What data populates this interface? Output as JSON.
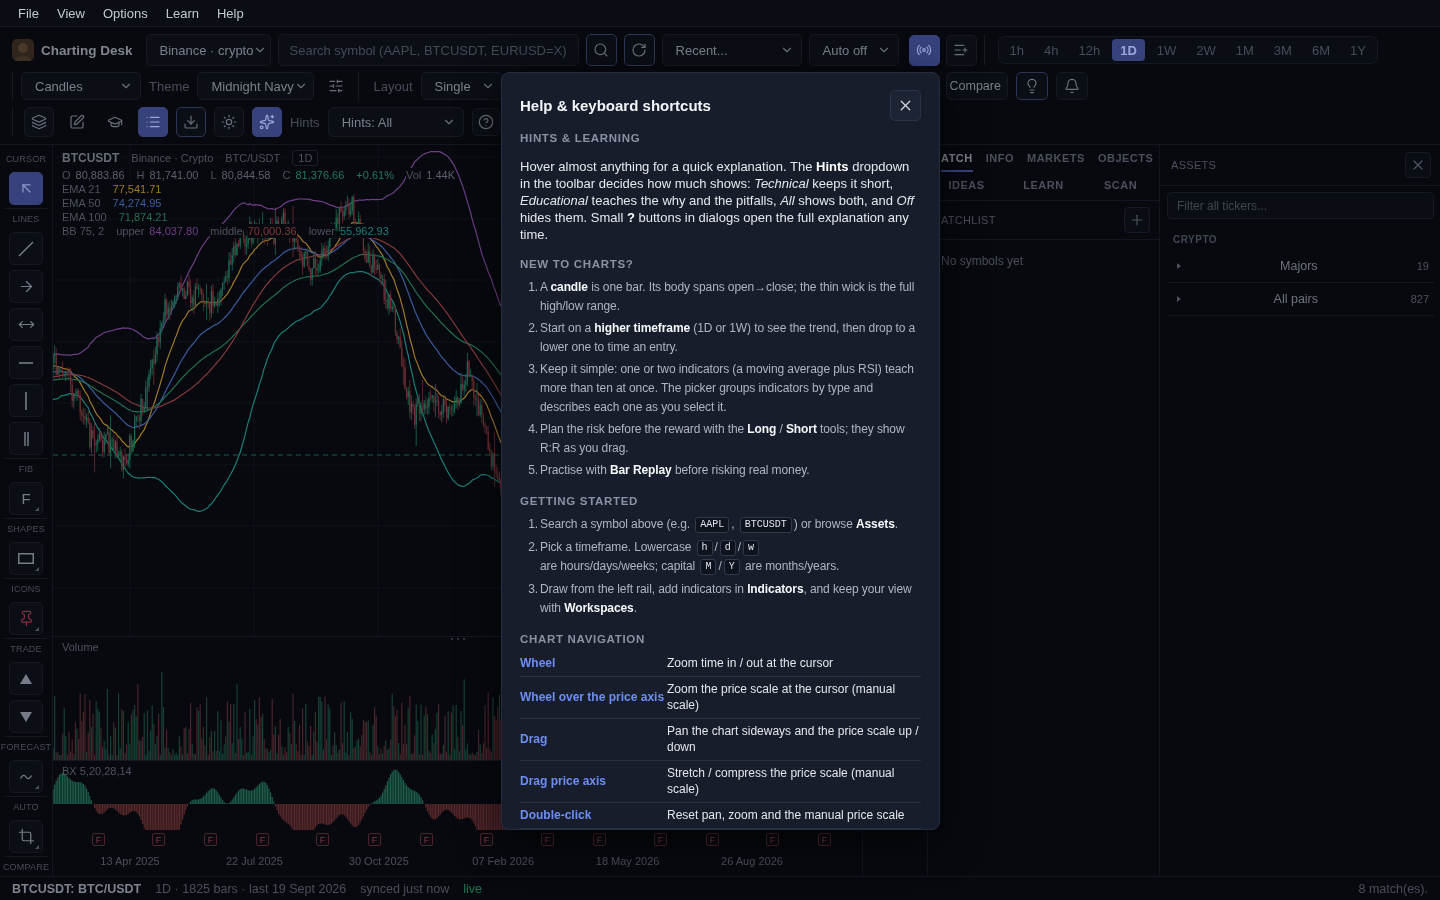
{
  "menu_bar": [
    "File",
    "View",
    "Options",
    "Learn",
    "Help"
  ],
  "top_bar": {
    "title": "Charting Desk",
    "exchange": "Binance · crypto",
    "search": {
      "placeholder": "Search symbol (AAPL, BTCUSDT, EURUSD=X)"
    },
    "search_actions": [
      {
        "kind": "search",
        "selected": false,
        "highlighted": true
      },
      {
        "kind": "refresh",
        "selected": false,
        "highlighted": true
      }
    ],
    "recent": "Recent...",
    "auto_refresh": "Auto off",
    "toggles": [
      {
        "kind": "broadcast",
        "selected": true,
        "highlighted": false
      },
      {
        "kind": "list-add",
        "selected": false,
        "highlighted": false
      }
    ],
    "timeframes": [
      {
        "label": "1h",
        "selected": false
      },
      {
        "label": "4h",
        "selected": false
      },
      {
        "label": "12h",
        "selected": false
      },
      {
        "label": "1D",
        "selected": true
      },
      {
        "label": "1W",
        "selected": false
      },
      {
        "label": "2W",
        "selected": false
      },
      {
        "label": "1M",
        "selected": false
      },
      {
        "label": "3M",
        "selected": false
      },
      {
        "label": "6M",
        "selected": false
      },
      {
        "label": "1Y",
        "selected": false
      }
    ]
  },
  "chart_bar": {
    "chart_type": "Candles",
    "theme": {
      "label": "Theme",
      "value": "Midnight Navy"
    },
    "settings": {
      "kind": "settings",
      "selected": false,
      "highlighted": false
    },
    "layout": {
      "label": "Layout",
      "value": "Single"
    },
    "compare": "Compare",
    "actions": [
      {
        "kind": "idea",
        "selected": false,
        "highlighted": true
      },
      {
        "kind": "alert",
        "selected": false,
        "highlighted": false
      }
    ]
  },
  "tool_bar": {
    "buttons": [
      {
        "kind": "layers",
        "selected": false,
        "highlighted": false
      },
      {
        "kind": "edit",
        "selected": false,
        "highlighted": false
      },
      {
        "kind": "learn",
        "selected": false,
        "highlighted": false
      },
      {
        "kind": "list",
        "selected": true,
        "highlighted": false
      },
      {
        "kind": "download",
        "selected": false,
        "highlighted": true
      },
      {
        "kind": "brightness",
        "selected": false,
        "highlighted": false
      },
      {
        "kind": "hints",
        "selected": true,
        "highlighted": false
      }
    ],
    "hints": {
      "label": "Hints",
      "value": "Hints: All"
    },
    "help": {
      "kind": "help",
      "selected": false,
      "highlighted": false
    }
  },
  "tool_rail": [
    {
      "label": "CURSOR",
      "tools": [
        {
          "kind": "cursor",
          "selected": true,
          "submenu": false
        }
      ]
    },
    {
      "label": "LINES",
      "tools": [
        {
          "kind": "line",
          "selected": false,
          "submenu": false
        },
        {
          "kind": "arrow",
          "selected": false,
          "submenu": false
        },
        {
          "kind": "range",
          "selected": false,
          "submenu": false
        },
        {
          "kind": "hline",
          "selected": false,
          "submenu": false
        },
        {
          "kind": "vline",
          "selected": false,
          "submenu": false
        },
        {
          "kind": "parallel",
          "selected": false,
          "submenu": false
        }
      ]
    },
    {
      "label": "FIB",
      "tools": [
        {
          "kind": "fib",
          "text": "F",
          "selected": false,
          "submenu": true
        }
      ]
    },
    {
      "label": "SHAPES",
      "tools": [
        {
          "kind": "rect",
          "selected": false,
          "submenu": true
        }
      ]
    },
    {
      "label": "ICONS",
      "tools": [
        {
          "kind": "pin",
          "selected": false,
          "submenu": true
        }
      ]
    },
    {
      "label": "TRADE",
      "tools": [
        {
          "kind": "long",
          "selected": false,
          "submenu": false
        },
        {
          "kind": "short",
          "selected": false,
          "submenu": false
        }
      ]
    },
    {
      "label": "FORECAST",
      "tools": [
        {
          "kind": "forecast",
          "selected": false,
          "submenu": true
        }
      ]
    },
    {
      "label": "AUTO",
      "tools": [
        {
          "kind": "auto",
          "selected": false,
          "submenu": true
        }
      ]
    },
    {
      "label": "COMPARE"
    }
  ],
  "legend": {
    "symbol": "BTCUSDT",
    "exchange": "Binance · Crypto",
    "pair": "BTC/USDT",
    "interval": "1D",
    "rising": true,
    "prices": [
      {
        "label": "O",
        "value": "80,883.86"
      },
      {
        "label": "H",
        "value": "81,741.00"
      },
      {
        "label": "L",
        "value": "80,844.58"
      },
      {
        "label": "C",
        "value": "81,376.66"
      }
    ],
    "change": "+0.61%",
    "volume": {
      "label": "Vol",
      "value": "1.44K"
    },
    "indicators": [
      {
        "name": "EMA 21",
        "values": [
          {
            "value": "77,541.71",
            "color": "#a07a28"
          }
        ]
      },
      {
        "name": "EMA 50",
        "values": [
          {
            "value": "74,274.95",
            "color": "#3a5c9c"
          }
        ]
      },
      {
        "name": "EMA 100",
        "values": [
          {
            "value": "71,874.21",
            "color": "#23704f"
          }
        ]
      },
      {
        "name": "BB 75, 2",
        "values": [
          {
            "label": "upper",
            "value": "84,037.80",
            "color": "#6e3f86"
          },
          {
            "label": "middle",
            "value": "70,000.36",
            "color": "#823a3a"
          },
          {
            "label": "lower",
            "value": "55,962.93",
            "color": "#1d7d74"
          }
        ]
      }
    ]
  },
  "volume_pane": {
    "label": "Volume"
  },
  "oscillator_pane": {
    "label": "BX 5,20,28,14",
    "markers": [
      "F",
      "F",
      "F",
      "F",
      "F",
      "F",
      "F",
      "F",
      "F",
      "F",
      "F",
      "F",
      "F",
      "F"
    ]
  },
  "time_axis": [
    "13 Apr 2025",
    "22 Jul 2025",
    "30 Oct 2025",
    "07 Feb 2026",
    "18 May 2026",
    "26 Aug 2026"
  ],
  "side_panel": {
    "tab_rows": [
      [
        {
          "label": "ATCH",
          "selected": true
        },
        {
          "label": "INFO",
          "selected": false
        },
        {
          "label": "MARKETS",
          "selected": false
        },
        {
          "label": "OBJECTS",
          "selected": false
        }
      ],
      [
        {
          "label": "IDEAS",
          "selected": false
        },
        {
          "label": "LEARN",
          "selected": false
        },
        {
          "label": "SCAN",
          "selected": false
        }
      ]
    ],
    "watchlist": {
      "title": "ATCHLIST",
      "empty_text": "No symbols yet"
    }
  },
  "assets_panel": {
    "title": "ASSETS",
    "filter": {
      "placeholder": "Filter all tickers..."
    },
    "category": "CRYPTO",
    "groups": [
      {
        "label": "Majors",
        "count": "19",
        "expanded": false
      },
      {
        "label": "All pairs",
        "count": "827",
        "expanded": false
      }
    ]
  },
  "status_bar": {
    "symbol": "BTCUSDT: BTC/USDT",
    "details": "1D · 1825 bars · last 19 Sept 2026",
    "sync": "synced just now",
    "connection": {
      "text": "live",
      "online": true
    },
    "matches": "8 match(es)."
  },
  "help_dialog": {
    "title": "Help & keyboard shortcuts",
    "sections": [
      {
        "kind": "paragraph",
        "heading": "HINTS & LEARNING",
        "text": "Hover almost anything for a quick explanation. The **Hints** dropdown in the toolbar decides how much shows: *Technical* keeps it short, *Educational* teaches the why and the pitfalls, *All* shows both, and *Off* hides them. Small **?** buttons in dialogs open the full explanation any time."
      },
      {
        "kind": "list",
        "heading": "NEW TO CHARTS?",
        "items": [
          {
            "number": "1.",
            "text": "A **candle** is one bar. Its body spans open→close; the thin wick is the full high/low range."
          },
          {
            "number": "2.",
            "text": "Start on a **higher timeframe** (1D or 1W) to see the trend, then drop to a lower one to time an entry."
          },
          {
            "number": "3.",
            "text": "Keep it simple: one or two indicators (a moving average plus RSI) teach more than ten at once. The picker groups indicators by type and describes each one as you select it."
          },
          {
            "number": "4.",
            "text": "Plan the risk before the reward with the **Long** / **Short** tools; they show R:R as you drag."
          },
          {
            "number": "5.",
            "text": "Practise with **Bar Replay** before risking real money."
          }
        ]
      },
      {
        "kind": "steps",
        "heading": "GETTING STARTED",
        "items": [
          {
            "number": "1.",
            "parts": [
              {
                "kind": "text",
                "text": "Search a symbol above (e.g. "
              },
              {
                "kind": "key",
                "text": "AAPL"
              },
              {
                "kind": "text",
                "text": ", "
              },
              {
                "kind": "key",
                "text": "BTCUSDT"
              },
              {
                "kind": "text",
                "text": ") or browse **Assets**."
              }
            ]
          },
          {
            "number": "2.",
            "parts": [
              {
                "kind": "text",
                "text": "Pick a timeframe. Lowercase "
              },
              {
                "kind": "key",
                "text": "h"
              },
              {
                "kind": "text",
                "text": "/"
              },
              {
                "kind": "key",
                "text": "d"
              },
              {
                "kind": "text",
                "text": "/"
              },
              {
                "kind": "key",
                "text": "w"
              },
              {
                "kind": "text",
                "text": " are hours/days/weeks; capital "
              },
              {
                "kind": "key",
                "text": "M"
              },
              {
                "kind": "text",
                "text": "/"
              },
              {
                "kind": "key",
                "text": "Y"
              },
              {
                "kind": "text",
                "text": " are months/years."
              }
            ]
          },
          {
            "number": "3.",
            "parts": [
              {
                "kind": "text",
                "text": "Draw from the left rail, add indicators in **Indicators**, and keep your view with **Workspaces**."
              }
            ]
          }
        ]
      },
      {
        "kind": "shortcuts",
        "heading": "CHART NAVIGATION",
        "rows": [
          {
            "action": "Wheel",
            "effect": "Zoom time in / out at the cursor"
          },
          {
            "action": "Wheel over the price axis",
            "effect": "Zoom the price scale at the cursor (manual scale)"
          },
          {
            "action": "Drag",
            "effect": "Pan the chart sideways and the price scale up / down"
          },
          {
            "action": "Drag price axis",
            "effect": "Stretch / compress the price scale (manual scale)"
          },
          {
            "action": "Double-click",
            "effect": "Reset pan, zoom and the manual price scale"
          }
        ]
      }
    ]
  }
}
